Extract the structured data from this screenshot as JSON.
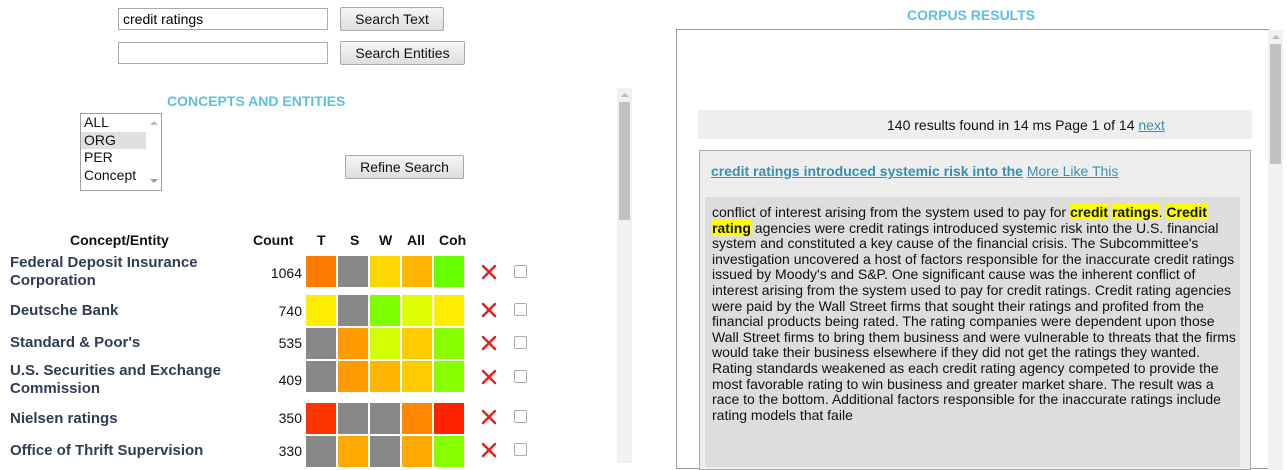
{
  "search": {
    "text_value": "credit ratings",
    "text_button": "Search Text",
    "entities_value": "",
    "entities_button": "Search Entities"
  },
  "concepts": {
    "heading": "CONCEPTS AND ENTITIES",
    "filter_options": [
      "ALL",
      "ORG",
      "PER",
      "Concept"
    ],
    "selected_option": "ORG",
    "refine_button": "Refine Search"
  },
  "table": {
    "headers": [
      "Concept/Entity",
      "Count",
      "T",
      "S",
      "W",
      "All",
      "Coh"
    ],
    "rows": [
      {
        "name": "Federal Deposit Insurance Corporation",
        "count": "1064",
        "colors": [
          "#ff7a00",
          "#888888",
          "#ffd700",
          "#ffb400",
          "#66ff00"
        ]
      },
      {
        "name": "Deutsche Bank",
        "count": "740",
        "colors": [
          "#ffee00",
          "#888888",
          "#7dff00",
          "#ddff00",
          "#ffee00"
        ]
      },
      {
        "name": "Standard & Poor's",
        "count": "535",
        "colors": [
          "#888888",
          "#ff9a00",
          "#d4ff00",
          "#ffcc00",
          "#88ff00"
        ]
      },
      {
        "name": "U.S. Securities and Exchange Commission",
        "count": "409",
        "colors": [
          "#888888",
          "#ff9a00",
          "#ffb400",
          "#ffcc00",
          "#88ff00"
        ]
      },
      {
        "name": "Nielsen ratings",
        "count": "350",
        "colors": [
          "#ff3300",
          "#888888",
          "#888888",
          "#ff8800",
          "#ff2200"
        ]
      },
      {
        "name": "Office of Thrift Supervision",
        "count": "330",
        "colors": [
          "#888888",
          "#ffaa00",
          "#888888",
          "#ffaa00",
          "#88ff00"
        ]
      }
    ]
  },
  "results": {
    "heading": "CORPUS RESULTS",
    "summary": "140 results found in 14 ms Page 1 of 14",
    "next_link": "next",
    "result_title": "credit ratings introduced systemic risk into the",
    "more_like_this": "More Like This",
    "snippet": [
      {
        "t": "conflict of interest arising from the system used to pay for "
      },
      {
        "t": "credit",
        "hl": true
      },
      {
        "t": " "
      },
      {
        "t": "ratings",
        "hl": true
      },
      {
        "t": ". "
      },
      {
        "t": "Credit",
        "hl": true
      },
      {
        "t": " "
      },
      {
        "t": "rating",
        "hl": true
      },
      {
        "t": " agencies were credit ratings introduced systemic risk into the U.S. financial system and constituted a key cause of the financial crisis. The Subcommittee's investigation uncovered a host of factors responsible for the inaccurate credit ratings issued by Moody's and S&P. One significant cause was the inherent conflict of interest arising from the system used to pay for credit ratings. Credit rating agencies were paid by the Wall Street firms that sought their ratings and profited from the financial products being rated. The rating companies were dependent upon those Wall Street firms to bring them business and were vulnerable to threats that the firms would take their business elsewhere if they did not get the ratings they wanted. Rating standards weakened as each credit rating agency competed to provide the most favorable rating to win business and greater market share. The result was a race to the bottom. Additional factors responsible for the inaccurate ratings include rating models that faile"
      }
    ]
  }
}
